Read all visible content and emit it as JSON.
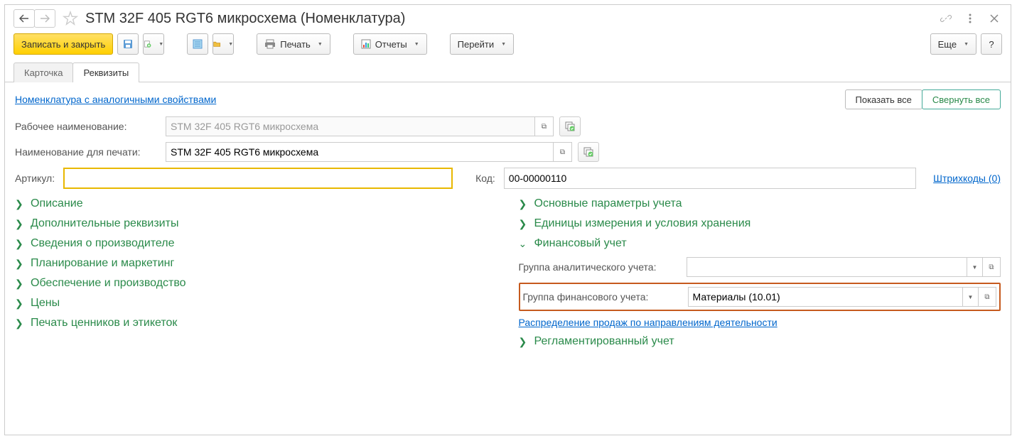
{
  "header": {
    "title": "STM 32F 405 RGT6 микросхема (Номенклатура)"
  },
  "toolbar": {
    "save_close": "Записать и закрыть",
    "print": "Печать",
    "reports": "Отчеты",
    "goto": "Перейти",
    "more": "Еще"
  },
  "tabs": {
    "card": "Карточка",
    "details": "Реквизиты"
  },
  "top": {
    "similar_link": "Номенклатура с аналогичными свойствами",
    "show_all": "Показать все",
    "collapse_all": "Свернуть все"
  },
  "form": {
    "work_name_label": "Рабочее наименование:",
    "work_name_value": "STM 32F 405 RGT6 микросхема",
    "print_name_label": "Наименование для печати:",
    "print_name_value": "STM 32F 405 RGT6 микросхема",
    "article_label": "Артикул:",
    "article_value": "",
    "code_label": "Код:",
    "code_value": "00-00000110",
    "barcodes_link": "Штрихкоды (0)"
  },
  "sections_left": [
    "Описание",
    "Дополнительные реквизиты",
    "Сведения о производителе",
    "Планирование и маркетинг",
    "Обеспечение и производство",
    "Цены",
    "Печать ценников и этикеток"
  ],
  "sections_right": {
    "s1": "Основные параметры учета",
    "s2": "Единицы измерения и условия хранения",
    "s3": "Финансовый учет",
    "analytic_label": "Группа аналитического учета:",
    "analytic_value": "",
    "financial_label": "Группа финансового учета:",
    "financial_value": "Материалы (10.01)",
    "distribution_link": "Распределение продаж по направлениям деятельности",
    "s4": "Регламентированный учет"
  }
}
